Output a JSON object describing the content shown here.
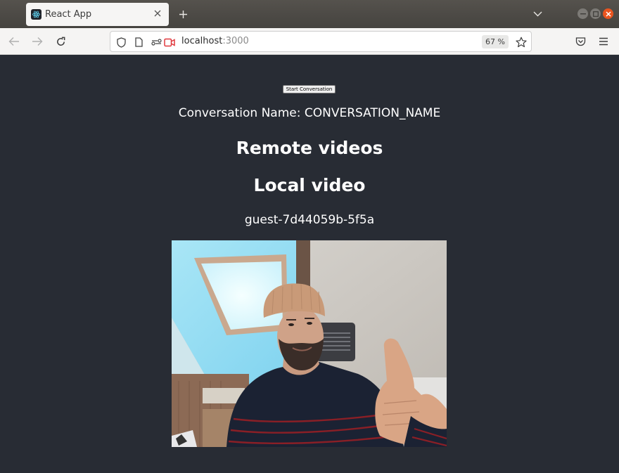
{
  "browser": {
    "tab": {
      "title": "React App",
      "favicon": "react-logo-icon"
    },
    "url": {
      "host": "localhost",
      "port": ":3000"
    },
    "zoom_level": "67 %"
  },
  "page": {
    "start_button_label": "Start Conversation",
    "conversation_label": "Conversation Name: CONVERSATION_NAME",
    "remote_heading": "Remote videos",
    "local_heading": "Local video",
    "local_participant": "guest-7d44059b-5f5a"
  },
  "video": {
    "description": "Local webcam feed: man in a beanie giving a thumbs-up under a skylight"
  },
  "colors": {
    "page_background": "#282c34",
    "titlebar": "#4a4844",
    "close_button": "#e9541f",
    "camera_indicator": "#e0393e"
  }
}
